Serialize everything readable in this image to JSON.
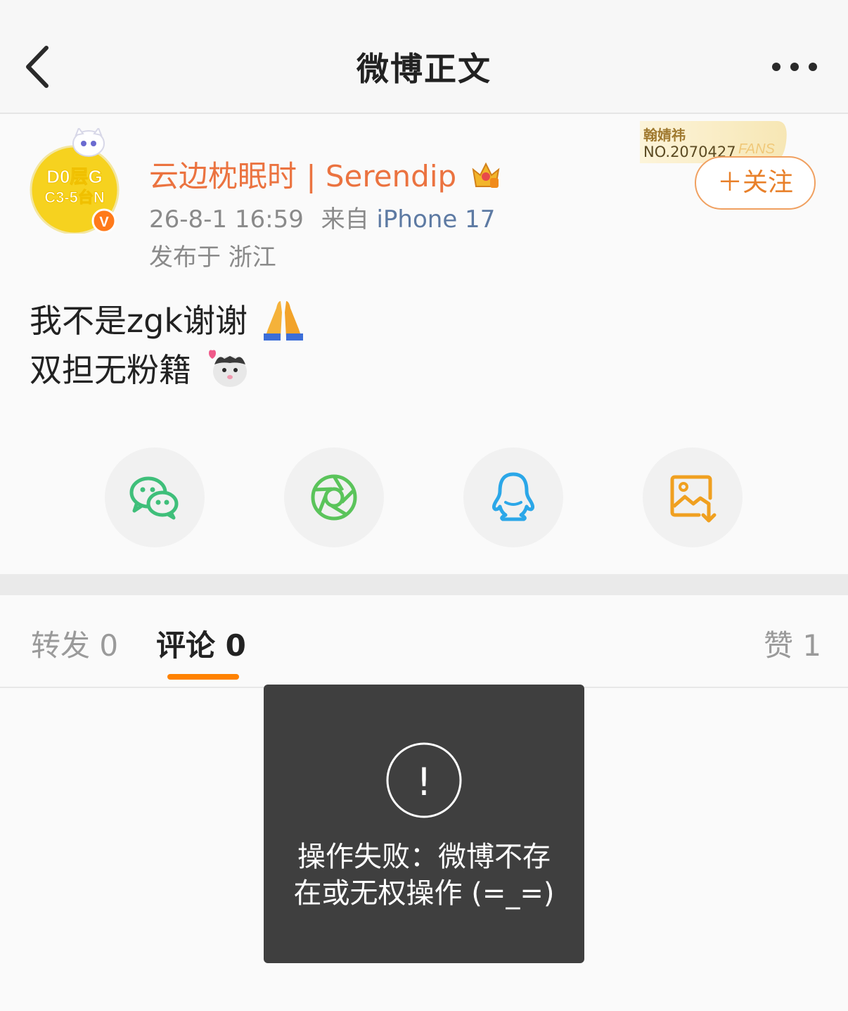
{
  "nav": {
    "title": "微博正文"
  },
  "author": {
    "name": "云边枕眠时 | Serendip",
    "time": "26-8-1 16:59",
    "source_prefix": "来自",
    "source": "iPhone 17",
    "location": "发布于 浙江",
    "avatar_text_top": "D0层G",
    "avatar_text_bottom": "C3-5台N",
    "verified_badge": "V"
  },
  "fans_badge": {
    "title": "翰婧祎",
    "number": "NO.2070427",
    "mark": "FANS"
  },
  "follow_button": {
    "label": "＋关注"
  },
  "post": {
    "line1": "我不是zgk谢谢",
    "line2": "双担无粉籍"
  },
  "share": {
    "items": [
      "wechat-icon",
      "moments-icon",
      "qq-icon",
      "save-image-icon"
    ]
  },
  "tabs": {
    "repost": "转发 0",
    "comment": "评论 0",
    "like": "赞 1"
  },
  "toast": {
    "icon": "!",
    "line1": "操作失败：微博不存",
    "line2": "在或无权操作 (=_=)"
  },
  "colors": {
    "accent": "#ff8200",
    "author_name": "#eb7340",
    "source_link": "#5d7aa3",
    "wechat": "#3fbf7a",
    "moments": "#5bc45b",
    "qq": "#2ba7e8",
    "save": "#f0a020"
  }
}
